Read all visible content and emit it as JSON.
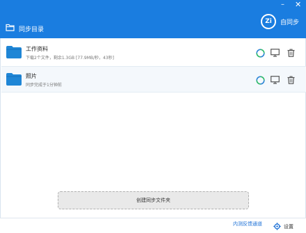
{
  "header": {
    "minimize_glyph": "–",
    "close_glyph": "✕",
    "directory_title": "同步目录",
    "brand_logo_text": "Zi",
    "brand_name": "自同步",
    "background_color": "#1a7de0"
  },
  "folders": [
    {
      "name": "工作资料",
      "status": "下载2个文件，剩余1.3GB [77.9MB/秒，43秒]",
      "icon": "folder-icon",
      "actions": [
        "sync-icon",
        "monitor-icon",
        "trash-icon"
      ]
    },
    {
      "name": "照片",
      "status": "同步完成于1分钟前",
      "icon": "folder-icon",
      "actions": [
        "sync-icon",
        "monitor-icon",
        "trash-icon"
      ]
    }
  ],
  "create_button_label": "创建同步文件夹",
  "footer": {
    "feedback_link": "内测反馈通道",
    "settings_label": "设置"
  },
  "colors": {
    "accent": "#1a7de0",
    "folder": "#1f86d6",
    "sync_green": "#2fb96b",
    "sync_blue": "#2f86d6",
    "link": "#1a6fd6"
  }
}
